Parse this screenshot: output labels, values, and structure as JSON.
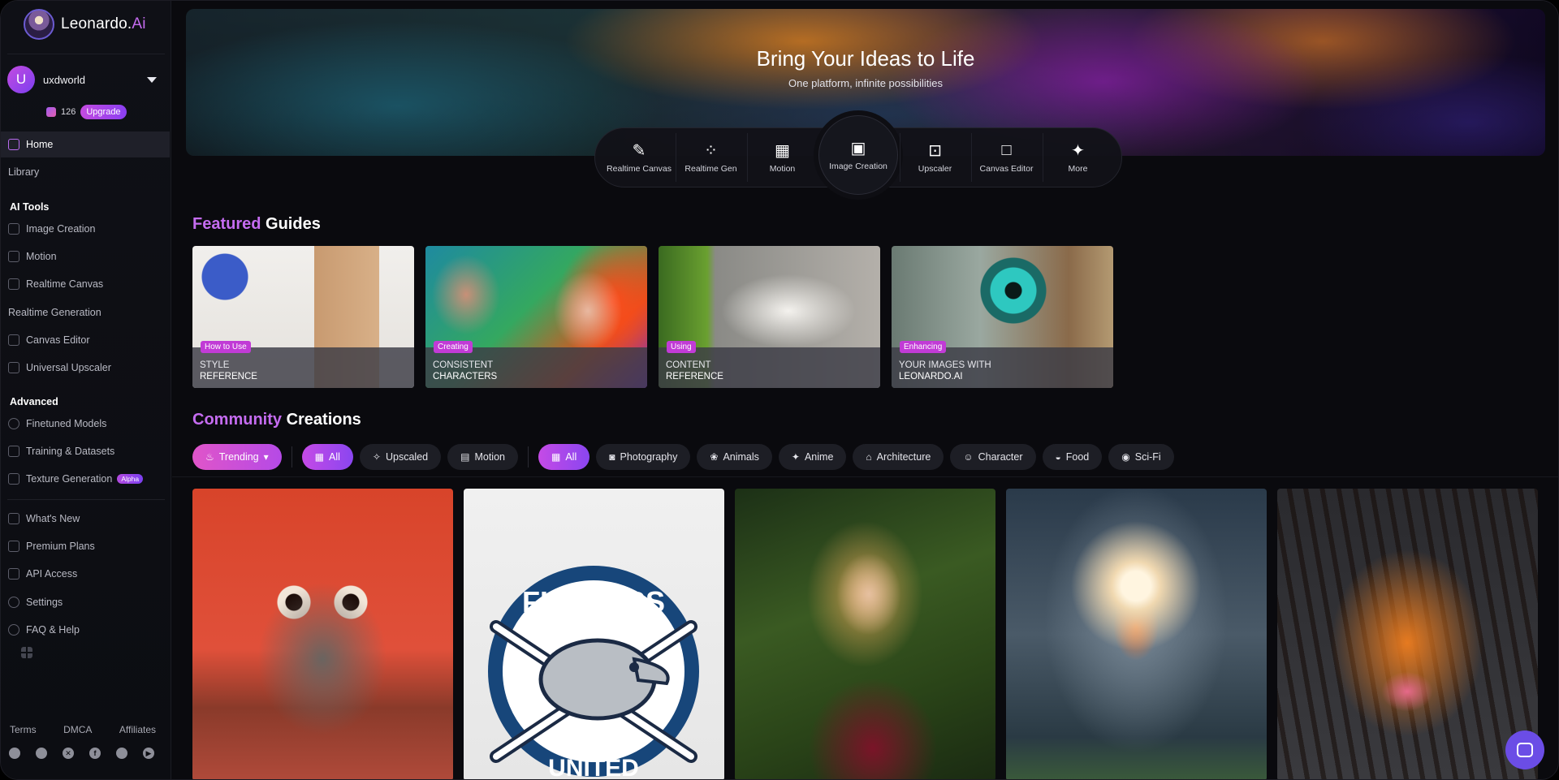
{
  "brand": {
    "name": "Leonardo.",
    "suffix": "Ai"
  },
  "user": {
    "initial": "U",
    "name": "uxdworld",
    "tokens": "126",
    "upgrade_label": "Upgrade"
  },
  "nav": {
    "home": "Home",
    "library": "Library",
    "ai_tools_title": "AI Tools",
    "ai_tools": [
      "Image Creation",
      "Motion",
      "Realtime Canvas",
      "Realtime Generation",
      "Canvas Editor",
      "Universal Upscaler"
    ],
    "advanced_title": "Advanced",
    "advanced": [
      "Finetuned Models",
      "Training & Datasets",
      "Texture Generation"
    ],
    "alpha_badge": "Alpha",
    "misc": [
      "What's New",
      "Premium Plans",
      "API Access",
      "Settings",
      "FAQ & Help"
    ]
  },
  "footer": {
    "links": [
      "Terms",
      "DMCA",
      "Affiliates"
    ]
  },
  "hero": {
    "title": "Bring Your Ideas to Life",
    "subtitle": "One platform, infinite possibilities"
  },
  "tools": [
    {
      "label": "Realtime Canvas",
      "icon": "brush-icon"
    },
    {
      "label": "Realtime Gen",
      "icon": "nodes-icon"
    },
    {
      "label": "Motion",
      "icon": "film-icon"
    },
    {
      "label": "Image Creation",
      "icon": "image-icon"
    },
    {
      "label": "Upscaler",
      "icon": "upscale-icon"
    },
    {
      "label": "Canvas Editor",
      "icon": "canvas-icon"
    },
    {
      "label": "More",
      "icon": "sparkle-icon"
    }
  ],
  "featured": {
    "accent": "Featured",
    "title": "Guides",
    "cards": [
      {
        "tag": "How to Use",
        "line1": "Style",
        "line2": "Reference"
      },
      {
        "tag": "Creating",
        "line1": "Consistent",
        "line2": "Characters"
      },
      {
        "tag": "Using",
        "line1": "Content",
        "line2": "Reference"
      },
      {
        "tag": "Enhancing",
        "line1": "Your images with",
        "line2": "Leonardo.Ai"
      }
    ]
  },
  "community": {
    "accent": "Community",
    "title": "Creations",
    "sort": "Trending",
    "type_filters": [
      "All",
      "Upscaled",
      "Motion"
    ],
    "category_filters": [
      "All",
      "Photography",
      "Animals",
      "Anime",
      "Architecture",
      "Character",
      "Food",
      "Sci-Fi"
    ]
  },
  "gallery": {
    "flippers_top": "FLIPPERS",
    "flippers_bottom": "UNITED"
  },
  "colors": {
    "accent": "#c56cf0",
    "chip_active": "#c54ae6",
    "tag": "#c13bd6",
    "chat": "#6b4de6"
  }
}
